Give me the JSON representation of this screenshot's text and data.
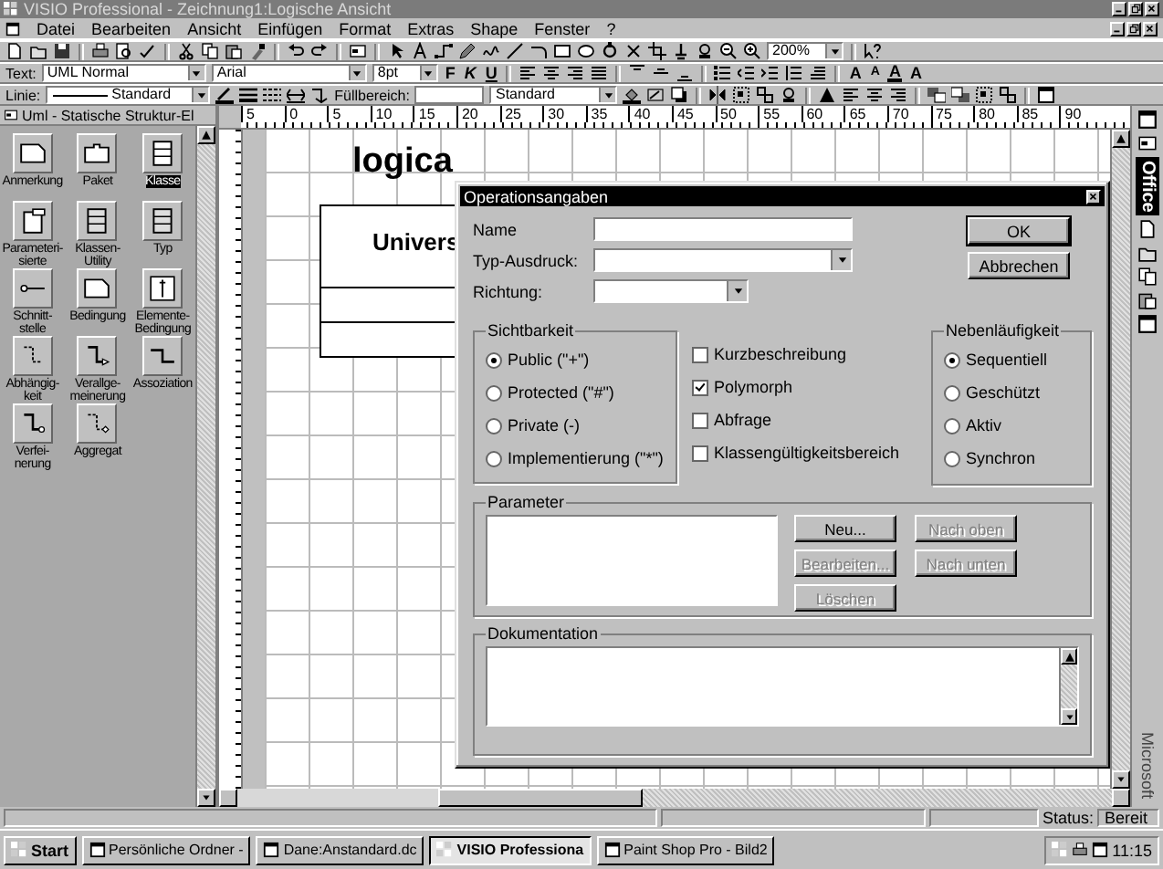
{
  "window": {
    "title": "VISIO Professional - Zeichnung1:Logische Ansicht"
  },
  "menu": [
    "Datei",
    "Bearbeiten",
    "Ansicht",
    "Einfügen",
    "Format",
    "Extras",
    "Shape",
    "Fenster",
    "?"
  ],
  "standard_toolbar": {
    "zoom": "200%"
  },
  "format_toolbar": {
    "text_label": "Text:",
    "style": "UML Normal",
    "font": "Arial",
    "size": "8pt",
    "style_buttons": [
      "F",
      "K",
      "U"
    ],
    "size_buttons": [
      "A",
      "A"
    ],
    "color_button": "A",
    "spacing_button": "A"
  },
  "line_toolbar": {
    "line_label": "Linie:",
    "line_style": "Standard",
    "fill_label": "Füllbereich:",
    "fill_style": "Standard"
  },
  "stencil": {
    "title": "Uml - Statische Struktur-El",
    "items": [
      {
        "label": "Anmerkung",
        "selected": false
      },
      {
        "label": "Paket",
        "selected": false
      },
      {
        "label": "Klasse",
        "selected": true
      },
      {
        "label": "Parameteri-\nsierte",
        "selected": false
      },
      {
        "label": "Klassen-\nUtility",
        "selected": false
      },
      {
        "label": "Typ",
        "selected": false
      },
      {
        "label": "Schnitt-\nstelle",
        "selected": false
      },
      {
        "label": "Bedingung",
        "selected": false
      },
      {
        "label": "Elemente-\nBedingung",
        "selected": false
      },
      {
        "label": "Abhängig-\nkeit",
        "selected": false
      },
      {
        "label": "Verallge-\nmeinerung",
        "selected": false
      },
      {
        "label": "Assoziation",
        "selected": false
      },
      {
        "label": "Verfei-\nnerung",
        "selected": false
      },
      {
        "label": "Aggregat",
        "selected": false
      }
    ]
  },
  "ruler_labels": [
    "5",
    "0",
    "5",
    "10",
    "15",
    "20",
    "25",
    "30",
    "35",
    "40",
    "45",
    "50",
    "55",
    "60",
    "65",
    "70",
    "75",
    "80",
    "85",
    "90"
  ],
  "canvas": {
    "title": "logica",
    "class_name": "Univers"
  },
  "dialog": {
    "title": "Operationsangaben",
    "fields": [
      {
        "label": "Name",
        "kind": "text"
      },
      {
        "label": "Typ-Ausdruck:",
        "kind": "combo"
      },
      {
        "label": "Richtung:",
        "kind": "short-combo"
      }
    ],
    "buttons": [
      "OK",
      "Abbrechen"
    ],
    "visibility": {
      "legend": "Sichtbarkeit",
      "options": [
        {
          "label": "Public (\"+\")",
          "selected": true
        },
        {
          "label": "Protected (\"#\")",
          "selected": false
        },
        {
          "label": "Private (-)",
          "selected": false
        },
        {
          "label": "Implementierung (\"*\")",
          "selected": false
        }
      ]
    },
    "checkboxes": [
      {
        "label": "Kurzbeschreibung",
        "checked": false
      },
      {
        "label": "Polymorph",
        "checked": true
      },
      {
        "label": "Abfrage",
        "checked": false
      },
      {
        "label": "Klassengültigkeitsbereich",
        "checked": false
      }
    ],
    "concurrency": {
      "legend": "Nebenläufigkeit",
      "options": [
        {
          "label": "Sequentiell",
          "selected": true
        },
        {
          "label": "Geschützt",
          "selected": false
        },
        {
          "label": "Aktiv",
          "selected": false
        },
        {
          "label": "Synchron",
          "selected": false
        }
      ]
    },
    "parameters": {
      "legend": "Parameter",
      "buttons": [
        {
          "label": "Neu...",
          "disabled": false
        },
        {
          "label": "Nach oben",
          "disabled": true
        },
        {
          "label": "Bearbeiten...",
          "disabled": true
        },
        {
          "label": "Nach unten",
          "disabled": true
        },
        {
          "label": "Löschen",
          "disabled": true
        }
      ]
    },
    "documentation": {
      "legend": "Dokumentation"
    }
  },
  "status_bar": {
    "label": "Status:",
    "value": "Bereit"
  },
  "office_bar": {
    "label": "Office",
    "footer": "Microsoft"
  },
  "taskbar": {
    "start": "Start",
    "tasks": [
      {
        "label": "Persönliche Ordner -",
        "selected": false
      },
      {
        "label": "Dane:Anstandard.dc",
        "selected": false
      },
      {
        "label": "VISIO Professiona",
        "selected": true
      },
      {
        "label": "Paint Shop Pro - Bild2",
        "selected": false
      }
    ],
    "clock": "11:15"
  }
}
